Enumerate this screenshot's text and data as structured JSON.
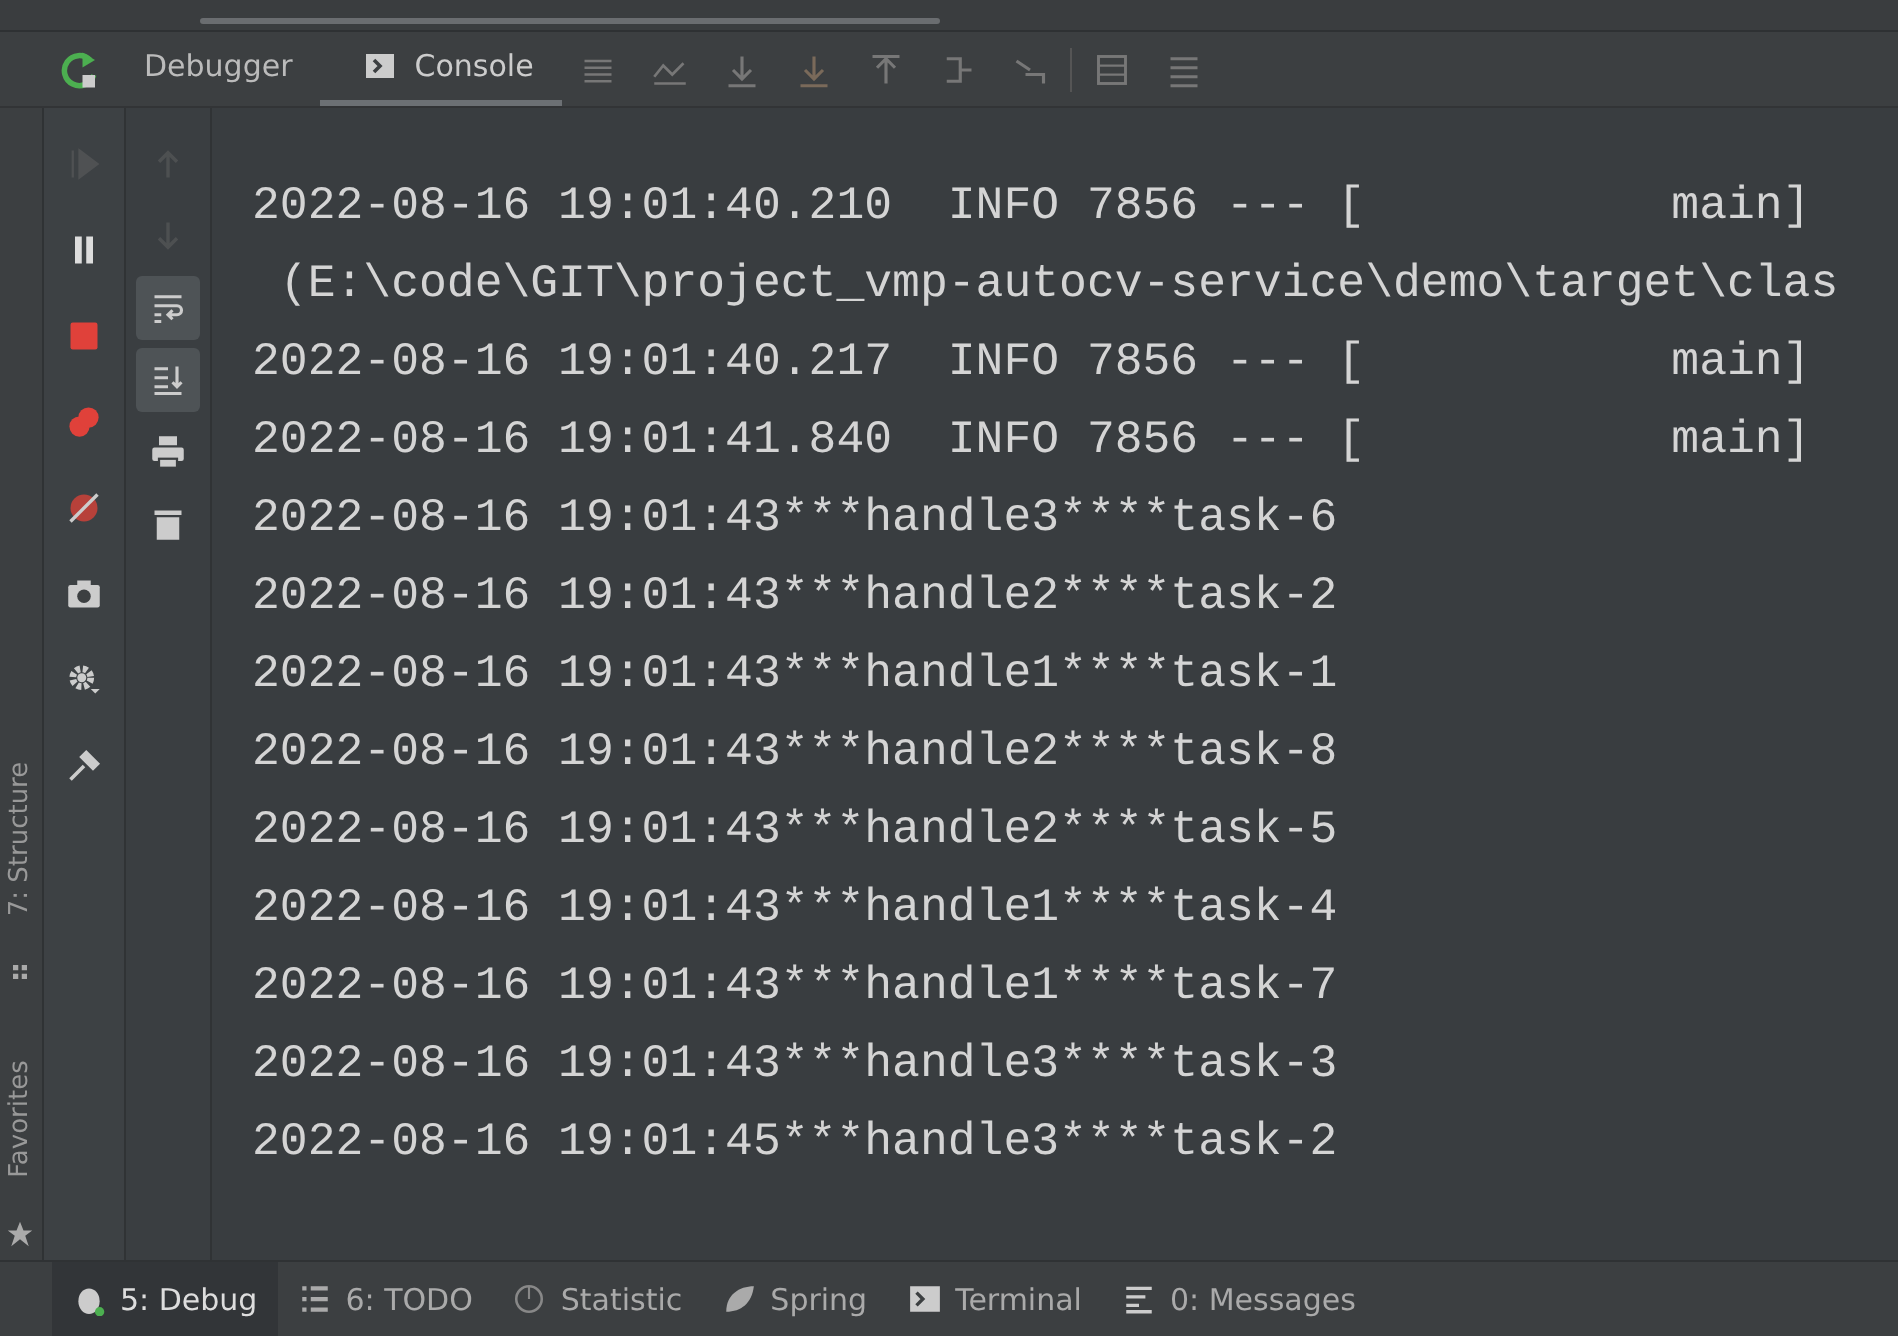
{
  "toolbar": {
    "tabs": [
      {
        "label": "Debugger",
        "selected": false
      },
      {
        "label": "Console",
        "selected": true
      }
    ]
  },
  "side_labels": [
    "7: Structure",
    "Favorites"
  ],
  "debug_actions": [
    {
      "disabled": true
    },
    {
      "disabled": false
    },
    {
      "disabled": false
    },
    {
      "disabled": false
    },
    {
      "disabled": false
    },
    {
      "disabled": false
    },
    {
      "disabled": false
    },
    {
      "disabled": false
    }
  ],
  "console_actions": [
    {
      "disabled": true,
      "on": false
    },
    {
      "disabled": true,
      "on": false
    },
    {
      "disabled": false,
      "on": true
    },
    {
      "disabled": false,
      "on": true
    },
    {
      "disabled": false,
      "on": false
    },
    {
      "disabled": false,
      "on": false
    }
  ],
  "console_lines": [
    "2022-08-16 19:01:40.210  INFO 7856 --- [           main]",
    " (E:\\code\\GIT\\project_vmp-autocv-service\\demo\\target\\clas",
    "2022-08-16 19:01:40.217  INFO 7856 --- [           main]",
    "2022-08-16 19:01:41.840  INFO 7856 --- [           main]",
    "2022-08-16 19:01:43***handle3****task-6",
    "2022-08-16 19:01:43***handle2****task-2",
    "2022-08-16 19:01:43***handle1****task-1",
    "2022-08-16 19:01:43***handle2****task-8",
    "2022-08-16 19:01:43***handle2****task-5",
    "2022-08-16 19:01:43***handle1****task-4",
    "2022-08-16 19:01:43***handle1****task-7",
    "2022-08-16 19:01:43***handle3****task-3",
    "2022-08-16 19:01:45***handle3****task-2"
  ],
  "bottom_tabs": [
    {
      "label": "5: Debug",
      "selected": true
    },
    {
      "label": "6: TODO",
      "selected": false
    },
    {
      "label": "Statistic",
      "selected": false
    },
    {
      "label": "Spring",
      "selected": false
    },
    {
      "label": "Terminal",
      "selected": false
    },
    {
      "label": "0: Messages",
      "selected": false
    }
  ]
}
